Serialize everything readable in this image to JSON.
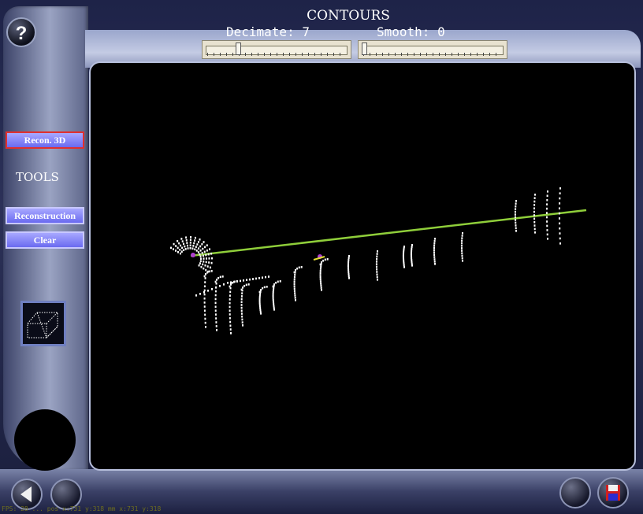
{
  "title": "CONTOURS",
  "decimate": {
    "label": "Decimate: 7",
    "level": 0.22
  },
  "smooth": {
    "label": "Smooth: 0",
    "level": 0.0
  },
  "help": {
    "label": "?"
  },
  "sidebar": {
    "recon_label": "Recon. 3D",
    "tools_label": "TOOLS",
    "reconstruction_label": "Reconstruction",
    "clear_label": "Clear"
  },
  "icons": {
    "help": "question-mark-icon",
    "cube": "wireframe-cube-icon",
    "back": "back-arrow-icon",
    "save": "floppy-disk-icon"
  },
  "status_bar": "FPS: 28 ... pos x:731 y:318 mm x:731 y:318",
  "colors": {
    "accent_button": "#7070f0",
    "active_border": "#e03030",
    "line": "#8fce3a",
    "viewport_bg": "#000000"
  }
}
